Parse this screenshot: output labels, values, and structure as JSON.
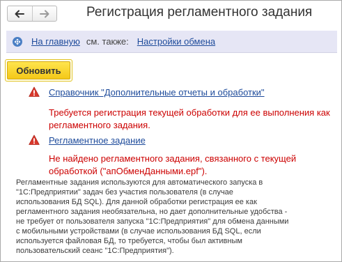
{
  "window": {
    "title": "Регистрация регламентного задания"
  },
  "nav": {
    "back_icon": "arrow-left-icon",
    "forward_icon": "arrow-right-icon"
  },
  "panel": {
    "icon": "navigation-icon",
    "home_link": "На главную",
    "see_also": "см. также:",
    "exchange_settings_link": "Настройки обмена"
  },
  "toolbar": {
    "refresh_label": "Обновить"
  },
  "items": [
    {
      "link": "Справочник \"Дополнительные отчеты и обработки\"",
      "error_lines": [
        "Требуется регистрация текущей обработки для ее выполнения как",
        "регламентного задания."
      ]
    },
    {
      "link": "Регламентное задание",
      "error_lines": [
        "Не найдено регламентного задания, связанного с текущей",
        "обработкой (\"апОбменДанными.epf\")."
      ]
    }
  ],
  "info_lines": [
    "Регламентные задания используются для автоматического запуска в",
    "\"1С:Предприятии\" задач без участия пользователя (в случае",
    "использования БД SQL). Для данной обработки регистрация ее как",
    "регламентного задания необязательна, но дает дополнительные удобства -",
    "не требует от пользователя запуска \"1С:Предприятия\" для обмена данными",
    "с мобильными устройствами (в случае использования БД SQL, если",
    "используется файловая БД, то требуется, чтобы был активным",
    "пользовательский сеанс \"1С:Предприятия\")."
  ],
  "colors": {
    "link": "#1e4b9b",
    "error": "#cc0000",
    "panel_bg": "#e6e6f5",
    "button_yellow": "#f4c818",
    "warning_red": "#d9382c"
  }
}
